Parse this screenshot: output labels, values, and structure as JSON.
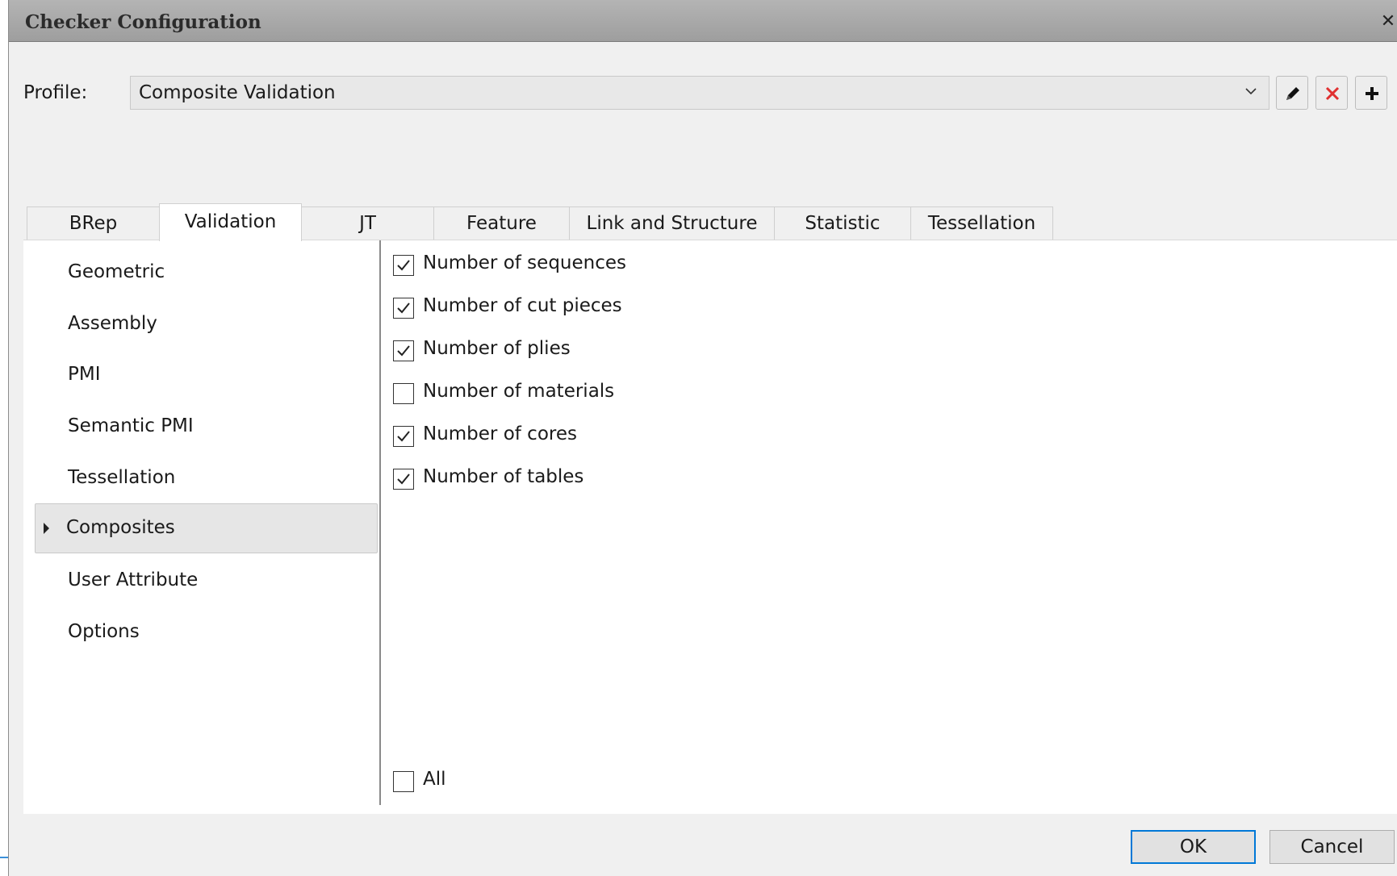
{
  "window": {
    "title": "Checker Configuration",
    "close_glyph": "✕"
  },
  "profile": {
    "label": "Profile:",
    "value": "Composite Validation"
  },
  "tabs": [
    {
      "label": "BRep"
    },
    {
      "label": "Validation"
    },
    {
      "label": "JT"
    },
    {
      "label": "Feature"
    },
    {
      "label": "Link and Structure"
    },
    {
      "label": "Statistic"
    },
    {
      "label": "Tessellation"
    }
  ],
  "active_tab": "Validation",
  "nav": [
    {
      "label": "Geometric"
    },
    {
      "label": "Assembly"
    },
    {
      "label": "PMI"
    },
    {
      "label": "Semantic PMI"
    },
    {
      "label": "Tessellation"
    },
    {
      "label": "Composites"
    },
    {
      "label": "User Attribute"
    },
    {
      "label": "Options"
    }
  ],
  "selected_nav": "Composites",
  "checks": [
    {
      "label": "Number of sequences",
      "checked": true
    },
    {
      "label": "Number of cut pieces",
      "checked": true
    },
    {
      "label": "Number of plies",
      "checked": true
    },
    {
      "label": "Number of materials",
      "checked": false
    },
    {
      "label": "Number of cores",
      "checked": true
    },
    {
      "label": "Number of tables",
      "checked": true
    }
  ],
  "all_check": {
    "label": "All",
    "checked": false
  },
  "buttons": {
    "ok": "OK",
    "cancel": "Cancel"
  },
  "icons": {
    "edit": "pencil-icon",
    "delete": "red-x-icon",
    "add": "plus-icon"
  },
  "colors": {
    "delete_icon": "#e03030",
    "default_button_border": "#0078d7"
  }
}
